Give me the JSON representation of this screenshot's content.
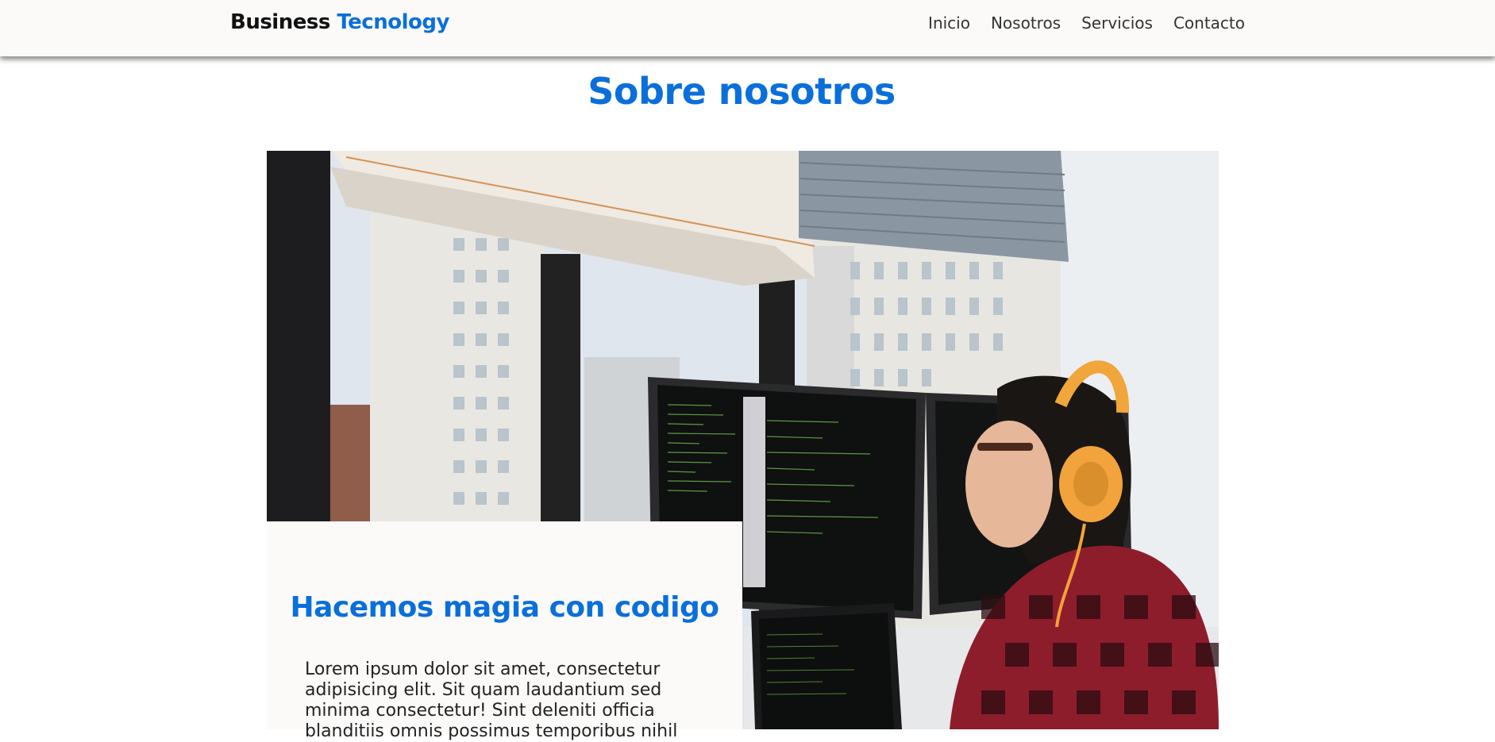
{
  "header": {
    "logo_main": "Business",
    "logo_accent": "Tecnology",
    "nav": [
      {
        "label": "Inicio"
      },
      {
        "label": "Nosotros"
      },
      {
        "label": "Servicios"
      },
      {
        "label": "Contacto"
      }
    ]
  },
  "about": {
    "title": "Sobre nosotros",
    "card_title": "Hacemos magia con codigo",
    "card_text": "Lorem ipsum dolor sit amet, consectetur adipisicing elit. Sit quam laudantium sed minima consectetur! Sint deleniti officia blanditiis omnis possimus temporibus nihil"
  },
  "colors": {
    "accent": "#0a6fdb",
    "header_bg": "#fbfaf9",
    "card_bg": "#fbfaf9"
  }
}
